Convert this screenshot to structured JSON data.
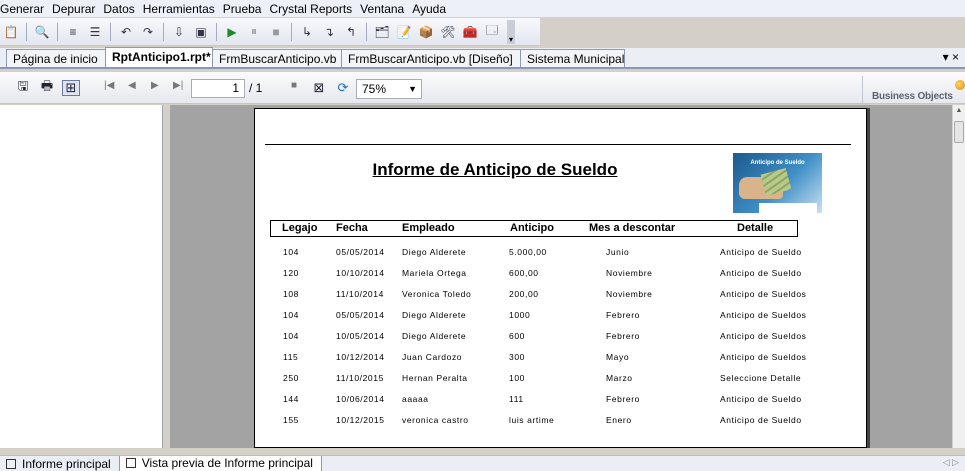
{
  "menu": [
    "Generar",
    "Depurar",
    "Datos",
    "Herramientas",
    "Prueba",
    "Crystal Reports",
    "Ventana",
    "Ayuda"
  ],
  "tabs": [
    {
      "label": "Página de inicio",
      "active": false
    },
    {
      "label": "RptAnticipo1.rpt*",
      "active": true
    },
    {
      "label": "FrmBuscarAnticipo.vb",
      "active": false
    },
    {
      "label": "FrmBuscarAnticipo.vb [Diseño]",
      "active": false
    },
    {
      "label": "Sistema Municipal",
      "active": false
    }
  ],
  "viewer": {
    "page_current": "1",
    "page_total": "/ 1",
    "zoom": "75%",
    "brand": "Business Objects"
  },
  "report": {
    "title": "Informe de Anticipo de Sueldo",
    "banner_title": "Anticipo de Sueldo",
    "columns": [
      "Legajo",
      "Fecha",
      "Empleado",
      "Anticipo",
      "Mes a descontar",
      "Detalle"
    ],
    "rows": [
      [
        "104",
        "05/05/2014",
        "Diego Alderete",
        "5.000,00",
        "Junio",
        "Anticipo de Sueldo"
      ],
      [
        "120",
        "10/10/2014",
        "Mariela Ortega",
        "600,00",
        "Noviembre",
        "Anticipo de Sueldo"
      ],
      [
        "108",
        "11/10/2014",
        "Veronica Toledo",
        "200,00",
        "Noviembre",
        "Anticipo de Sueldos"
      ],
      [
        "104",
        "05/05/2014",
        "Diego Alderete",
        "1000",
        "Febrero",
        "Anticipo de Sueldos"
      ],
      [
        "104",
        "10/05/2014",
        "Diego Alderete",
        "600",
        "Febrero",
        "Anticipo de Sueldos"
      ],
      [
        "115",
        "10/12/2014",
        "Juan Cardozo",
        "300",
        "Mayo",
        "Anticipo de Sueldos"
      ],
      [
        "250",
        "11/10/2015",
        "Hernan Peralta",
        "100",
        "Marzo",
        "Seleccione Detalle"
      ],
      [
        "144",
        "10/06/2014",
        "aaaaa",
        "111",
        "Febrero",
        "Anticipo de Sueldo"
      ],
      [
        "155",
        "10/12/2015",
        "veronica castro",
        "luis artime",
        "Enero",
        "Anticipo de Sueldo"
      ]
    ]
  },
  "status_tabs": [
    {
      "label": "Informe principal",
      "active": false
    },
    {
      "label": "Vista previa de Informe principal",
      "active": true
    }
  ]
}
